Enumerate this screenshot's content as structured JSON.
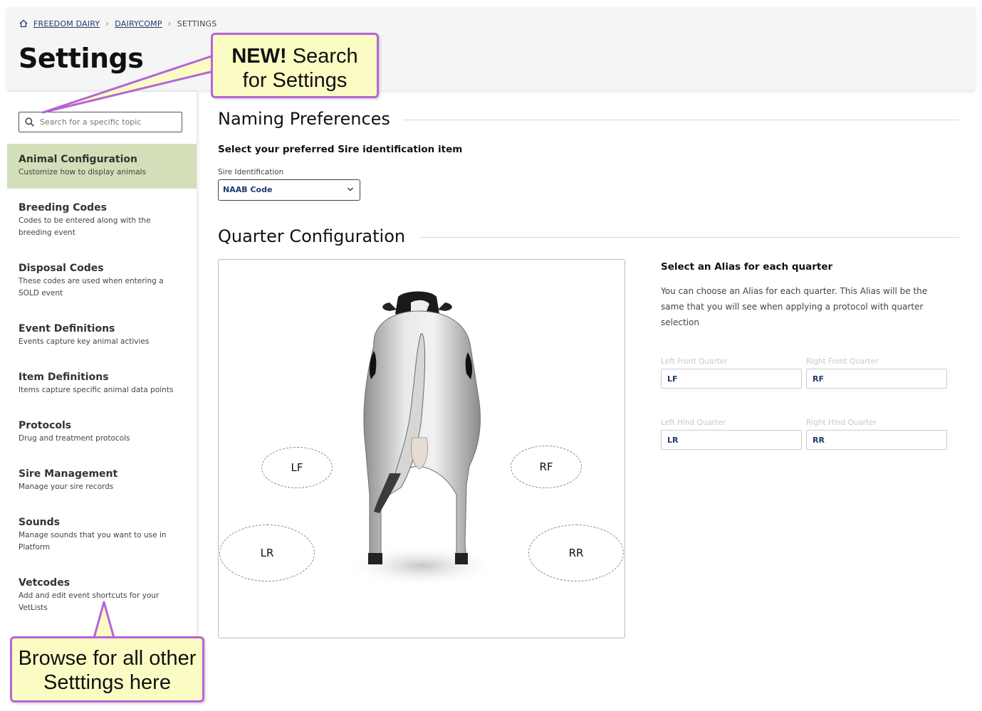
{
  "breadcrumb": {
    "items": [
      {
        "label": "FREEDOM DAIRY",
        "link": true
      },
      {
        "label": "DAIRYCOMP",
        "link": true
      },
      {
        "label": "SETTINGS",
        "link": false
      }
    ]
  },
  "page_title": "Settings",
  "search": {
    "placeholder": "Search for a specific topic"
  },
  "sidebar": {
    "items": [
      {
        "title": "Animal Configuration",
        "desc": "Customize how to display animals"
      },
      {
        "title": "Breeding Codes",
        "desc": "Codes to be entered along with the breeding event"
      },
      {
        "title": "Disposal Codes",
        "desc": "These codes are used when entering a SOLD event"
      },
      {
        "title": "Event Definitions",
        "desc": "Events capture key animal activies"
      },
      {
        "title": "Item Definitions",
        "desc": "Items capture specific animal data points"
      },
      {
        "title": "Protocols",
        "desc": "Drug and treatment protocols"
      },
      {
        "title": "Sire Management",
        "desc": "Manage your sire records"
      },
      {
        "title": "Sounds",
        "desc": "Manage sounds that you want to use in Platform"
      },
      {
        "title": "Vetcodes",
        "desc": "Add and edit event shortcuts for your VetLists"
      }
    ]
  },
  "naming": {
    "title": "Naming Preferences",
    "subtitle": "Select your preferred Sire identification item",
    "field_label": "Sire Identification",
    "selected": "NAAB Code"
  },
  "quarter": {
    "title": "Quarter Configuration",
    "ellipses": {
      "lf": "LF",
      "rf": "RF",
      "lr": "LR",
      "rr": "RR"
    },
    "alias_heading": "Select an Alias for each quarter",
    "alias_desc": "You can choose an Alias for each quarter. This Alias will be the same that you will see when applying a protocol with quarter selection",
    "fields": {
      "lf_label": "Left Front Quarter",
      "lf_value": "LF",
      "rf_label": "Right Front Quarter",
      "rf_value": "RF",
      "lr_label": "Left Hind Quarter",
      "lr_value": "LR",
      "rr_label": "Right Hind Quarter",
      "rr_value": "RR"
    }
  },
  "callouts": {
    "search_bold": "NEW!",
    "search_text1": " Search",
    "search_text2": "for Settings",
    "browse_line1": "Browse for all other",
    "browse_line2": "Setttings here"
  },
  "colors": {
    "active_nav": "#d2dfb8",
    "callout_fill": "#fbfbc4",
    "callout_border": "#b565d6",
    "link": "#1f3a6e"
  }
}
